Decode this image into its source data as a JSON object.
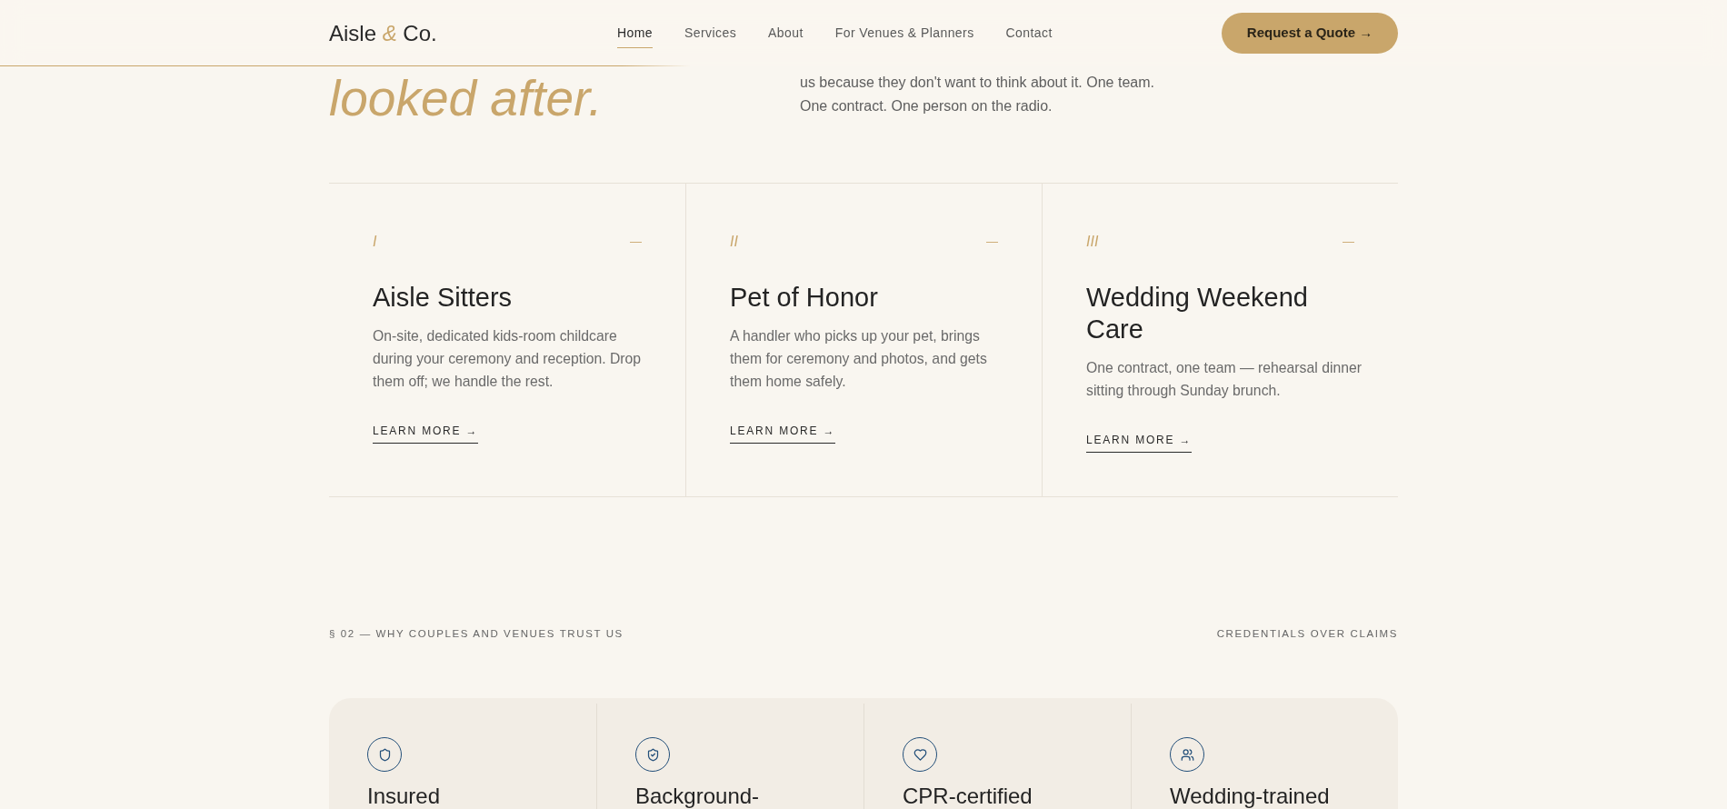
{
  "header": {
    "logo": "Aisle *&* Co.",
    "nav": [
      {
        "label": "Home",
        "selected": true
      },
      {
        "label": "Services",
        "selected": false
      },
      {
        "label": "About",
        "selected": false
      },
      {
        "label": "For Venues & Planners",
        "selected": false
      },
      {
        "label": "Contact",
        "selected": false
      }
    ],
    "cta": "Request a Quote →"
  },
  "hero": {
    "heading": "looked after.",
    "text": "us because they don't want to think about it. One team. One contract. One person on the radio."
  },
  "services": [
    {
      "numeral": "I",
      "marker": "—",
      "title": "Aisle Sitters",
      "description": "On-site, dedicated kids-room childcare during your ceremony and reception. Drop them off; we handle the rest.",
      "link": "LEARN MORE →"
    },
    {
      "numeral": "II",
      "marker": "—",
      "title": "Pet of Honor",
      "description": "A handler who picks up your pet, brings them for ceremony and photos, and gets them home safely.",
      "link": "LEARN MORE →"
    },
    {
      "numeral": "III",
      "marker": "—",
      "title": "Wedding Weekend Care",
      "description": "One contract, one team — rehearsal dinner sitting through Sunday brunch.",
      "link": "LEARN MORE →"
    }
  ],
  "trust": {
    "label": "§ 02 — WHY COUPLES AND VENUES TRUST US",
    "tagline": "CREDENTIALS OVER CLAIMS",
    "items": [
      {
        "title": "Insured"
      },
      {
        "title": "Background-"
      },
      {
        "title": "CPR-certified"
      },
      {
        "title": "Wedding-trained"
      }
    ]
  }
}
